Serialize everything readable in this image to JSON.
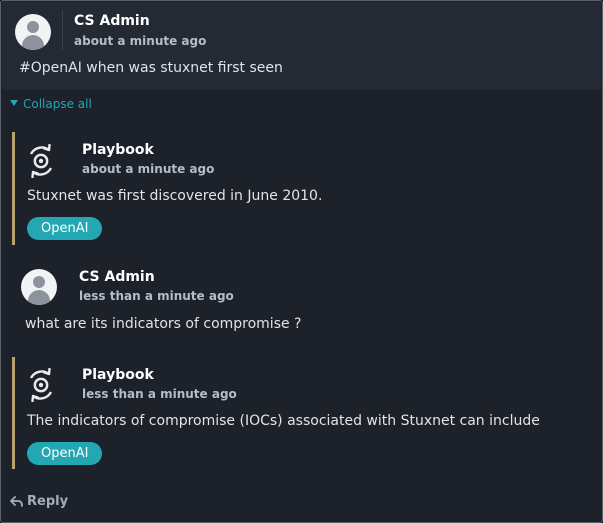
{
  "colors": {
    "accent": "#22a7b3",
    "thread_bar": "#b7a36b",
    "panel": "#1c212a",
    "top_post": "#242a33"
  },
  "top_post": {
    "author": "CS Admin",
    "time": "about a minute ago",
    "message": "#OpenAI when was stuxnet first seen",
    "avatar_icon": "user-avatar-icon"
  },
  "collapse_all": {
    "label": "Collapse all",
    "icon": "caret-down-icon"
  },
  "replies": [
    {
      "author": "Playbook",
      "time": "about a minute ago",
      "message": "Stuxnet was first discovered in June 2010.",
      "badge": "OpenAI",
      "icon": "playbook-cycle-icon"
    },
    {
      "author": "CS Admin",
      "time": "less than a minute ago",
      "message": "what are its indicators of compromise ?",
      "icon": "user-avatar-icon"
    },
    {
      "author": "Playbook",
      "time": "less than a minute ago",
      "message": "The indicators of compromise (IOCs) associated with Stuxnet can include",
      "badge": "OpenAI",
      "icon": "playbook-cycle-icon"
    }
  ],
  "reply_action": {
    "label": "Reply",
    "icon": "reply-arrow-icon"
  }
}
